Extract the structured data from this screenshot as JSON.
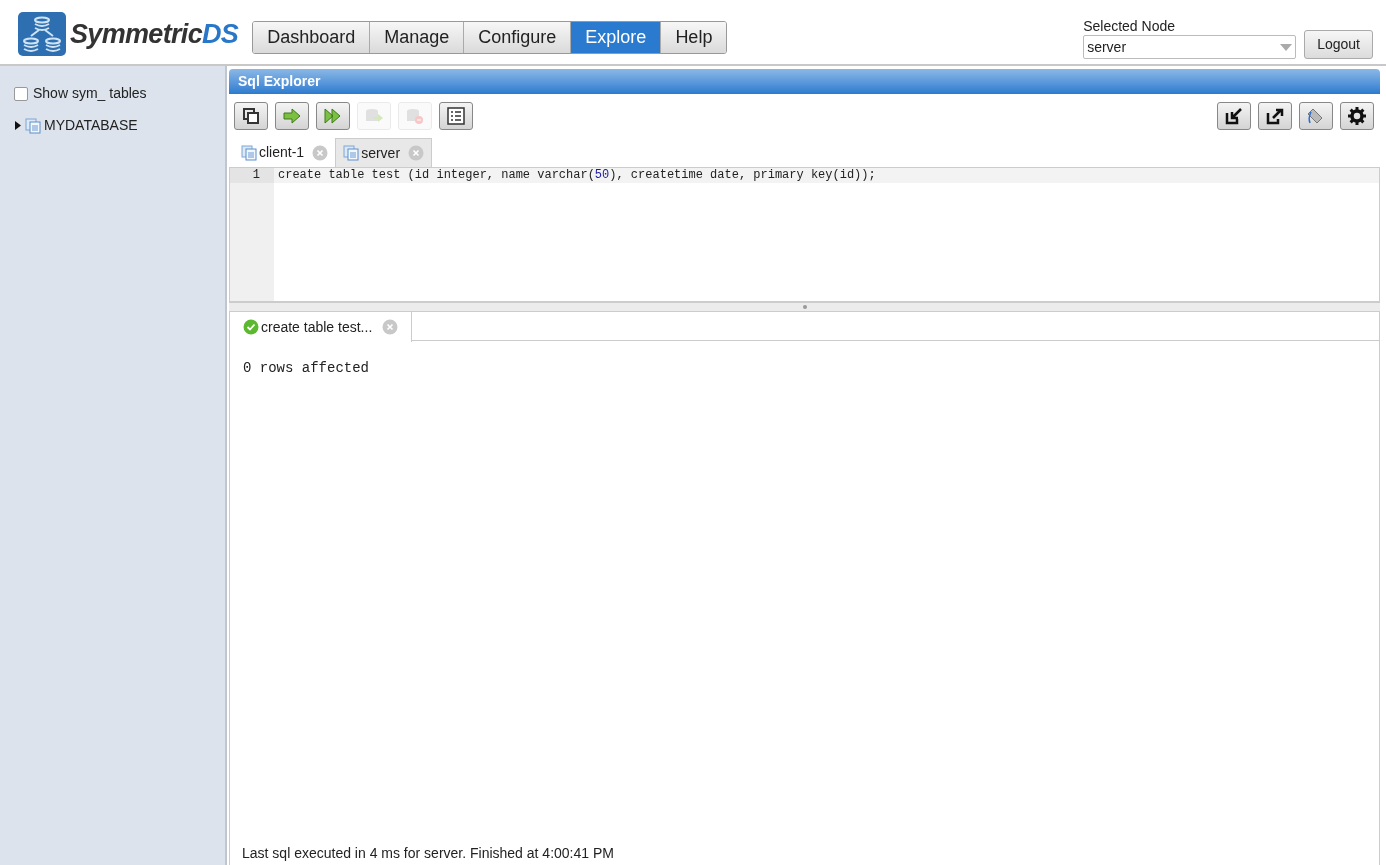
{
  "logo": {
    "word": "Symmetric",
    "suffix": "DS"
  },
  "nav": [
    {
      "label": "Dashboard",
      "selected": false
    },
    {
      "label": "Manage",
      "selected": false
    },
    {
      "label": "Configure",
      "selected": false
    },
    {
      "label": "Explore",
      "selected": true
    },
    {
      "label": "Help",
      "selected": false
    }
  ],
  "node_selector": {
    "label": "Selected Node",
    "value": "server"
  },
  "logout_button": "Logout",
  "sidebar": {
    "show_sym_tables": {
      "label": "Show sym_ tables",
      "checked": false
    },
    "tree": [
      {
        "label": "MYDATABASE",
        "expanded": false
      }
    ]
  },
  "panel": {
    "title": "Sql Explorer"
  },
  "toolbar_left": [
    {
      "kind": "new-window",
      "disabled": false
    },
    {
      "kind": "run",
      "disabled": false
    },
    {
      "kind": "run-script",
      "disabled": false
    },
    {
      "kind": "commit",
      "disabled": true
    },
    {
      "kind": "rollback",
      "disabled": true
    },
    {
      "kind": "history",
      "disabled": false
    }
  ],
  "toolbar_right": [
    {
      "kind": "import"
    },
    {
      "kind": "export"
    },
    {
      "kind": "fill"
    },
    {
      "kind": "settings"
    }
  ],
  "editor_tabs": [
    {
      "label": "client-1",
      "selected": false
    },
    {
      "label": "server",
      "selected": true
    }
  ],
  "editor": {
    "lines": [
      {
        "number": "1",
        "text": "create table test (id integer, name varchar(50), createtime date, primary key(id));"
      }
    ]
  },
  "result_tabs": [
    {
      "label": "create table test...",
      "succeeded": true,
      "selected": true
    }
  ],
  "result": {
    "output": "0 rows affected"
  },
  "status_bar": "Last sql executed in 4 ms for server. Finished at 4:00:41 PM"
}
